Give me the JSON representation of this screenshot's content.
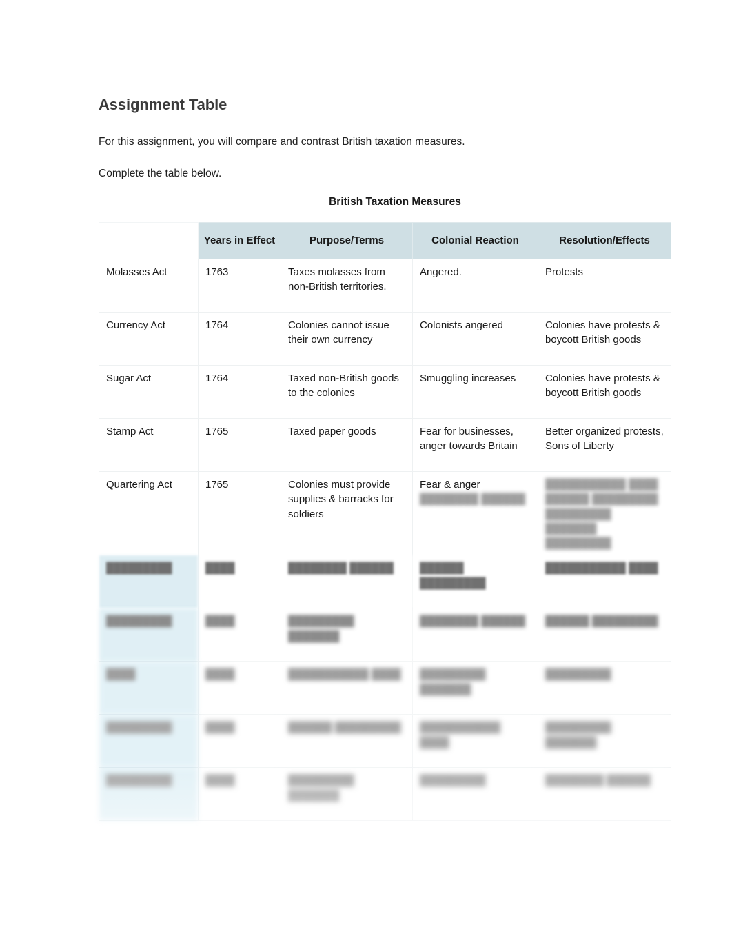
{
  "document": {
    "title": "Assignment Table",
    "paragraphs": [
      "For this assignment, you will compare and contrast British taxation measures.",
      "Complete the table below."
    ],
    "table_title": "British Taxation Measures"
  },
  "colors": {
    "header_fill": "#cfdfe4",
    "first_column_fill": "#d6e7ec",
    "first_column_fill_lower": "#b5dcea",
    "grid_line": "#eef1f2",
    "heading_text": "#3b3b3b",
    "body_text": "#1a1a1a",
    "page_background": "#ffffff"
  },
  "table": {
    "columns": [
      {
        "key": "act",
        "label": ""
      },
      {
        "key": "years",
        "label": "Years in Effect"
      },
      {
        "key": "purpose",
        "label": "Purpose/Terms"
      },
      {
        "key": "reaction",
        "label": "Colonial Reaction"
      },
      {
        "key": "resolution",
        "label": "Resolution/Effects"
      }
    ],
    "rows": [
      {
        "act": "Molasses Act",
        "years": "1763",
        "purpose": "Taxes molasses from non-British territories.",
        "reaction": "Angered.",
        "resolution": "Protests",
        "state": "visible"
      },
      {
        "act": "Currency Act",
        "years": "1764",
        "purpose": "Colonies cannot issue their own currency",
        "reaction": "Colonists angered",
        "resolution": "Colonies have protests & boycott British goods",
        "state": "visible"
      },
      {
        "act": "Sugar Act",
        "years": "1764",
        "purpose": "Taxed non-British goods to the colonies",
        "reaction": "Smuggling increases",
        "resolution": "Colonies have protests & boycott British goods",
        "state": "visible"
      },
      {
        "act": "Stamp Act",
        "years": "1765",
        "purpose": "Taxed paper goods",
        "reaction": "Fear for businesses, anger towards Britain",
        "resolution": "Better organized protests, Sons of Liberty",
        "state": "visible"
      },
      {
        "act": "Quartering Act",
        "years": "1765",
        "purpose": "Colonies must provide supplies & barracks for soldiers",
        "reaction": "Fear & anger",
        "reaction_obscured": "obscured text",
        "resolution": "",
        "resolution_obscured": "obscured text obscured text obscured",
        "state": "partially-obscured"
      },
      {
        "act": "",
        "years": "",
        "purpose": "",
        "reaction": "",
        "resolution": "",
        "state": "obscured",
        "blur_level": 2
      },
      {
        "act": "",
        "years": "",
        "purpose": "",
        "reaction": "",
        "resolution": "",
        "state": "obscured",
        "blur_level": 3
      },
      {
        "act": "",
        "years": "",
        "purpose": "",
        "reaction": "",
        "resolution": "",
        "state": "obscured",
        "blur_level": 4
      },
      {
        "act": "",
        "years": "",
        "purpose": "",
        "reaction": "",
        "resolution": "",
        "state": "obscured",
        "blur_level": 5
      },
      {
        "act": "",
        "years": "",
        "purpose": "",
        "reaction": "",
        "resolution": "",
        "state": "obscured",
        "blur_level": 6
      }
    ],
    "obscured_placeholder": {
      "short": "████",
      "word": "█████████",
      "line_a": "████████ ██████",
      "line_b": "███████████ ████",
      "line_c": "██████ █████████",
      "line_d": "█████████ ███████"
    }
  }
}
